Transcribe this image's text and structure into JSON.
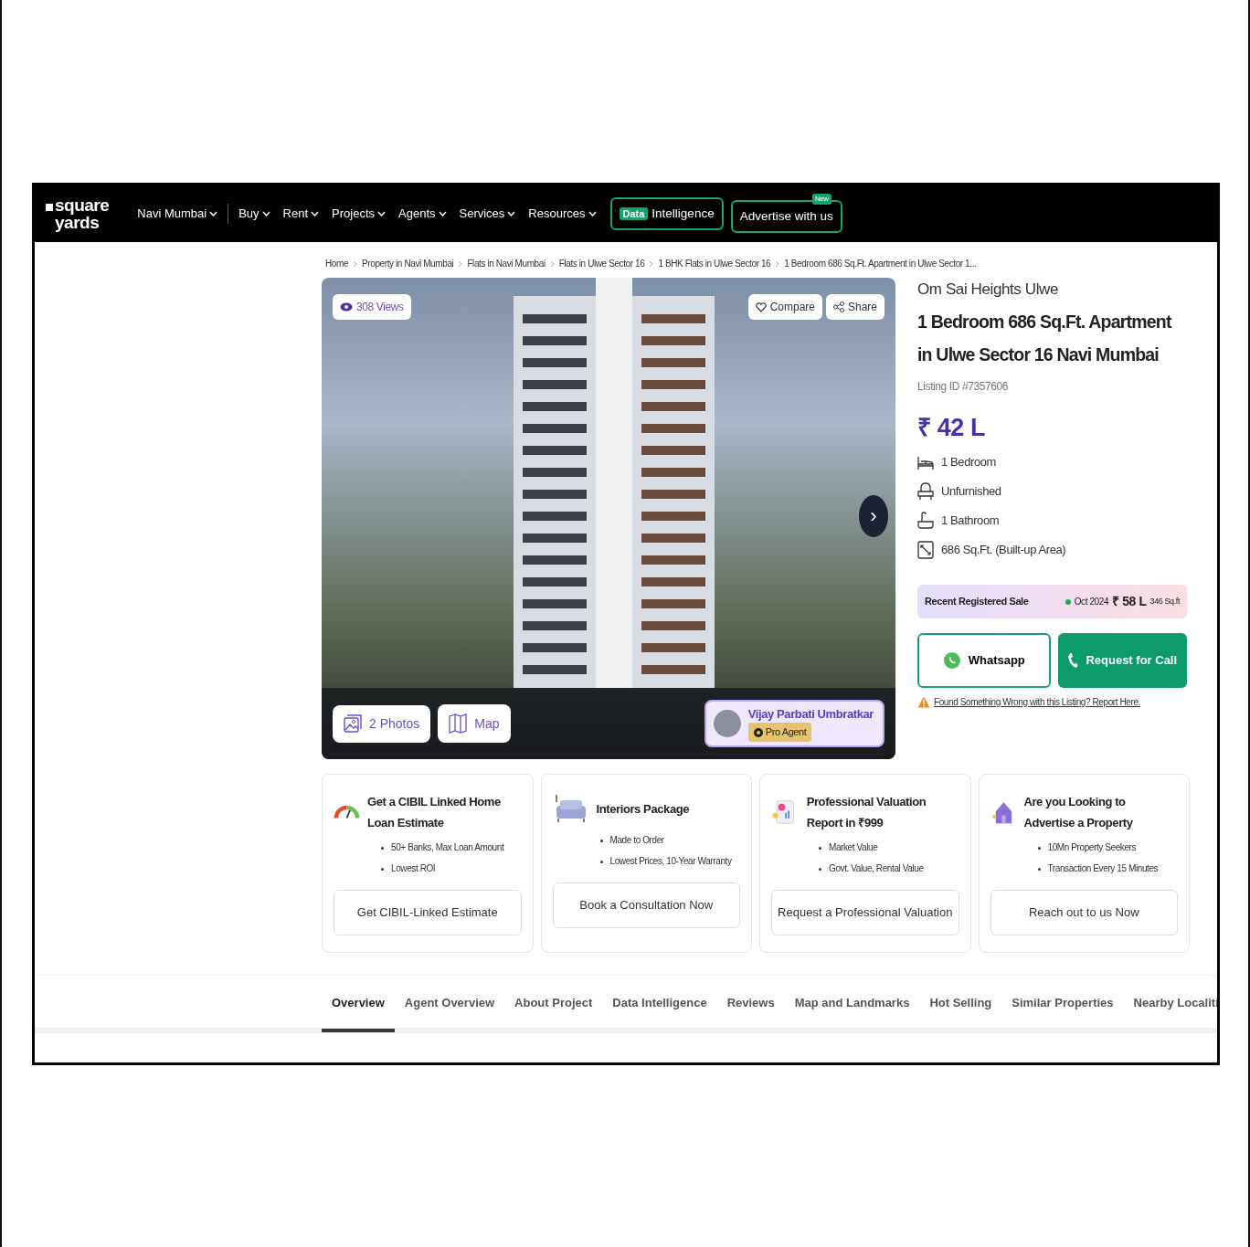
{
  "navbar": {
    "logo": [
      "square",
      "yards"
    ],
    "menu": [
      {
        "label": "Navi Mumbai",
        "kind": "dropdown"
      },
      {
        "label": "Buy",
        "kind": "dropdown"
      },
      {
        "label": "Rent",
        "kind": "dropdown"
      },
      {
        "label": "Projects",
        "kind": "dropdown"
      },
      {
        "label": "Agents",
        "kind": "dropdown"
      },
      {
        "label": "Services",
        "kind": "dropdown"
      },
      {
        "label": "Resources",
        "kind": "dropdown"
      }
    ],
    "data_button": {
      "tag": "Data",
      "label": "Intelligence"
    },
    "advertise_button": {
      "label": "Advertise with us",
      "badge": "New"
    }
  },
  "breadcrumbs": [
    "Home",
    "Property in Navi Mumbai",
    "Flats in Navi Mumbai",
    "Flats in Ulwe Sector 16",
    "1 BHK Flats in Ulwe Sector 16",
    "1 Bedroom 686 Sq.Ft. Apartment in Ulwe Sector 1..."
  ],
  "gallery": {
    "views": "308 Views",
    "compare": "Compare",
    "share": "Share",
    "next": "›",
    "photos": "2 Photos",
    "map": "Map",
    "agent": {
      "name": "Vijay Parbati Umbratkar",
      "badge": "Pro Agent"
    }
  },
  "listing": {
    "project": "Om Sai Heights Ulwe",
    "title": "1 Bedroom 686 Sq.Ft. Apartment in Ulwe Sector 16 Navi Mumbai",
    "listing_id": "Listing ID #7357606",
    "price": "₹ 42 L",
    "features": [
      {
        "kind": "bed",
        "label": "1 Bedroom"
      },
      {
        "kind": "sofa",
        "label": "Unfurnished"
      },
      {
        "kind": "bath",
        "label": "1 Bathroom"
      },
      {
        "kind": "area",
        "label": "686 Sq.Ft. (Built-up Area)"
      }
    ],
    "recent_sale": {
      "label": "Recent Registered Sale",
      "date": "Oct 2024",
      "price": "₹ 58 L",
      "area": "346 Sq.ft"
    },
    "whatsapp": "Whatsapp",
    "call": "Request for Call",
    "report": "Found Something Wrong with this Listing? Report Here."
  },
  "services": [
    {
      "kind": "gauge",
      "title": "Get a CIBIL Linked Home Loan Estimate",
      "points": [
        "50+ Banks, Max Loan Amount",
        "Lowest ROI"
      ],
      "button": "Get CIBIL-Linked Estimate"
    },
    {
      "kind": "sofa",
      "title": "Interiors Package",
      "points": [
        "Made to Order",
        "Lowest Prices, 10-Year Warranty"
      ],
      "button": "Book a Consultation Now"
    },
    {
      "kind": "report",
      "title": "Professional Valuation Report in ₹999",
      "points": [
        "Market Value",
        "Govt. Value, Rental Value"
      ],
      "button": "Request a Professional Valuation"
    },
    {
      "kind": "house",
      "title": "Are you Looking to Advertise a Property",
      "points": [
        "10Mn Property Seekers",
        "Transaction Every 15 Minutes"
      ],
      "button": "Reach out to us Now"
    }
  ],
  "tabs": [
    {
      "label": "Overview",
      "selected": true
    },
    {
      "label": "Agent Overview",
      "selected": false
    },
    {
      "label": "About Project",
      "selected": false
    },
    {
      "label": "Data Intelligence",
      "selected": false
    },
    {
      "label": "Reviews",
      "selected": false
    },
    {
      "label": "Map and Landmarks",
      "selected": false
    },
    {
      "label": "Hot Selling",
      "selected": false
    },
    {
      "label": "Similar Properties",
      "selected": false
    },
    {
      "label": "Nearby Localiti",
      "selected": false
    }
  ]
}
